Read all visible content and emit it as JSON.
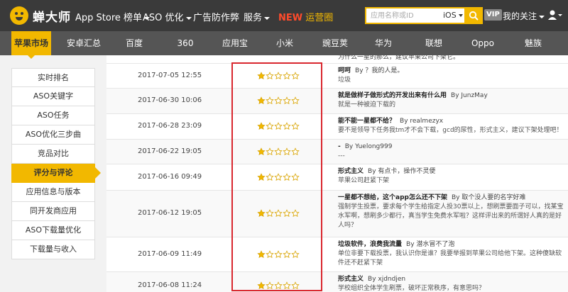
{
  "header": {
    "logo_text": "蝉大师",
    "nav": [
      {
        "label": "App Store 榜单",
        "has_caret": true
      },
      {
        "label": "ASO 优化",
        "has_caret": true
      },
      {
        "label": "广告防作弊",
        "has_caret": false
      },
      {
        "label": "服务",
        "has_caret": true
      }
    ],
    "new_badge": "NEW",
    "new_label": "运营圈",
    "search_placeholder": "应用名称或ID",
    "search_os": "iOS",
    "vip_label": "VIP",
    "my_follow": "我的关注",
    "icons": {
      "search": "search-icon",
      "user": "user-icon",
      "logo": "cicada-logo-icon"
    }
  },
  "markets": [
    "苹果市场",
    "安卓汇总",
    "百度",
    "360",
    "应用宝",
    "小米",
    "豌豆荚",
    "华为",
    "联想",
    "Oppo",
    "魅族"
  ],
  "active_market": 0,
  "sidebar": {
    "items": [
      "实时排名",
      "ASO关键字",
      "ASO任务",
      "ASO优化三步曲",
      "竞品对比",
      "评分与评论",
      "应用信息与版本",
      "同开发商应用",
      "ASO下载量优化",
      "下载量与收入"
    ],
    "active": 5
  },
  "reviews": {
    "top_partial": "为什么一星的那么，建议苹果公司下架它。",
    "rows": [
      {
        "date": "2017-07-05 12:55",
        "stars": 1,
        "title": "呵呵",
        "by": "By ？我的人是。",
        "body": "垃圾"
      },
      {
        "date": "2017-06-30 10:06",
        "stars": 1,
        "title": "就是做样子做形式的开发出来有什么用",
        "by": "By JunzMay",
        "body": "就是一种被迫下载的"
      },
      {
        "date": "2017-06-28 23:09",
        "stars": 1,
        "title": "能不能一星都不给？",
        "by": "By realmezyx",
        "body": "要不是领导下任务我tm才不会下载，gcd的尿性，形式主义，建议下架处理吧！"
      },
      {
        "date": "2017-06-22 19:05",
        "stars": 1,
        "title": "-",
        "by": "By Yuelong999",
        "body": "---"
      },
      {
        "date": "2017-06-16 09:49",
        "stars": 1,
        "title": "形式主义",
        "by": "By 有点卡，操作不灵便",
        "body": "苹果公司赶紧下架"
      },
      {
        "date": "2017-06-12 19:05",
        "stars": 1,
        "title": "一星都不想给，这个app怎么还不下架",
        "by": "By 取个没人要的名字好难",
        "body": "强制学生投票，要求每个学生给指定人投30票以上，想刷票要面子可以，找某宝水军啊，想刷多少都行，真当学生免费水军啦？这样评出来的所谓好人真的是好人吗？"
      },
      {
        "date": "2017-06-09 11:49",
        "stars": 1,
        "title": "垃圾软件，浪费我流量",
        "by": "By 潜水冒不了泡",
        "body": "单位非要下载投票，我认识你是谁？我要举报到苹果公司给他下架。这种傻缺软件还不赶紧下架"
      },
      {
        "date": "2017-06-08 11:24",
        "stars": 1,
        "title": "形式主义",
        "by": "By xjdndjen",
        "body": "学校组织全体学生刷票，破坏正常秩序，有意思吗？"
      }
    ]
  },
  "colors": {
    "brand": "#f2b800",
    "nav_bg": "#3a3a3a",
    "market_bg": "#555555",
    "highlight": "#d9272e",
    "new": "#ff4b2b"
  }
}
